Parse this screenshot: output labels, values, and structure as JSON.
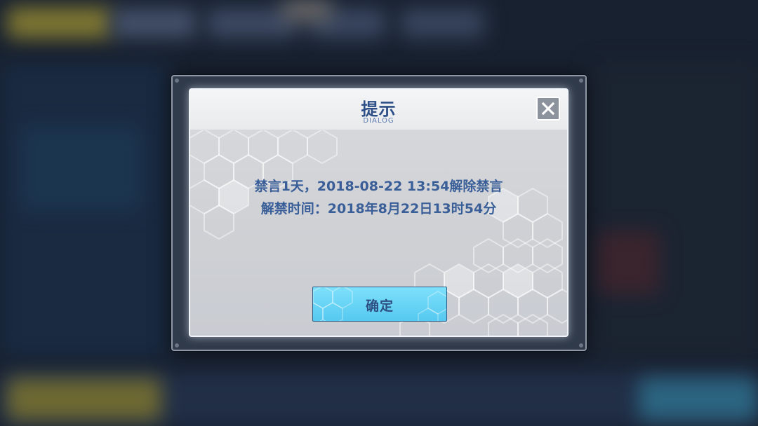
{
  "dialog": {
    "title": "提示",
    "subtitle": "DIALOG",
    "message_line1": "禁言1天，2018-08-22 13:54解除禁言",
    "message_line2": "解禁时间：2018年8月22日13时54分",
    "confirm_label": "确定"
  },
  "colors": {
    "title": "#2d4f87",
    "message": "#3a5f98",
    "button_fill": "#55c9f0",
    "close_fill": "#8c939d"
  },
  "icons": {
    "close": "close-icon"
  }
}
